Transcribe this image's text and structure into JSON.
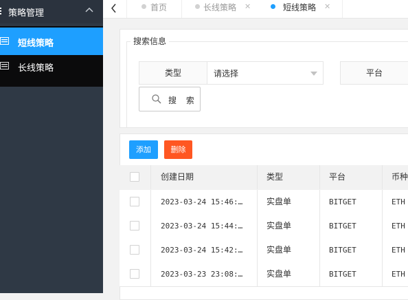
{
  "sidebar": {
    "group_label": "策略管理",
    "items": [
      {
        "label": "短线策略",
        "active": true
      },
      {
        "label": "长线策略",
        "active": false
      }
    ]
  },
  "tabs": [
    {
      "label": "首页",
      "active": false
    },
    {
      "label": "长线策略",
      "active": false
    },
    {
      "label": "短线策略",
      "active": true
    }
  ],
  "search": {
    "legend": "搜索信息",
    "type_label": "类型",
    "type_value": "请选择",
    "platform_label": "平台",
    "search_button": "搜 索"
  },
  "toolbar": {
    "add_label": "添加",
    "delete_label": "删除"
  },
  "table": {
    "headers": [
      "创建日期",
      "类型",
      "平台",
      "币种"
    ],
    "rows": [
      [
        "2023-03-24 15:46:…",
        "实盘单",
        "BITGET",
        "ETH"
      ],
      [
        "2023-03-24 15:44:…",
        "实盘单",
        "BITGET",
        "ETH"
      ],
      [
        "2023-03-24 15:42:…",
        "实盘单",
        "BITGET",
        "ETH"
      ],
      [
        "2023-03-23 23:08:…",
        "实盘单",
        "BITGET",
        "ETH"
      ]
    ]
  },
  "colors": {
    "accent": "#1e9fff",
    "danger": "#ff5722",
    "sidebar": "#2f3945"
  },
  "icons": {
    "group": "strategy-icon",
    "item": "list-icon",
    "back": "chevron-left-icon",
    "search": "search-icon"
  }
}
